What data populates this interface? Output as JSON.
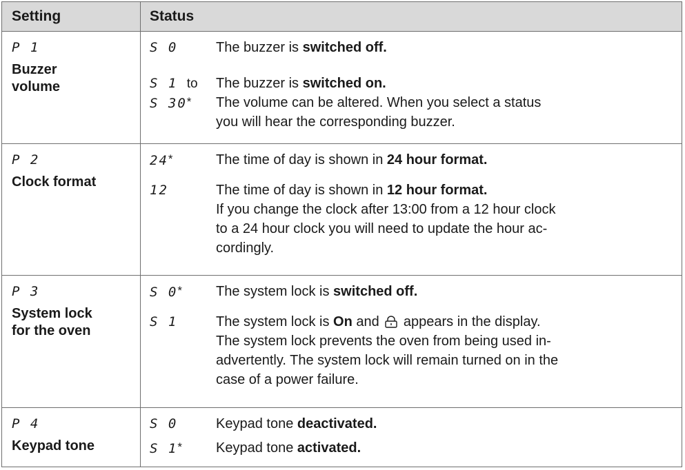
{
  "header": {
    "setting": "Setting",
    "status": "Status"
  },
  "rows": [
    {
      "code": "P 1",
      "name_l1": "Buzzer",
      "name_l2": "volume",
      "statuses": [
        {
          "code": "S 0",
          "star": "",
          "text_pre": "The buzzer is ",
          "text_bold": "switched off.",
          "extra": ""
        },
        {
          "code": "S 1",
          "to": "to",
          "code2": "S 30",
          "star2": "*",
          "text_pre": "The buzzer is ",
          "text_bold": "switched on.",
          "extra1": "The volume can be altered. When you select a status",
          "extra2": "you will hear the corresponding buzzer."
        }
      ]
    },
    {
      "code": "P 2",
      "name_l1": "Clock format",
      "statuses": [
        {
          "code": "24",
          "star": "*",
          "text_pre": "The time of day is shown in ",
          "text_bold": "24 hour format."
        },
        {
          "code": "12",
          "star": "",
          "text_pre": "The time of day is shown in ",
          "text_bold": "12 hour format.",
          "extra1": "If you change the clock after 13:00 from a 12 hour clock",
          "extra2": "to a 24 hour clock you will need to update the hour ac-",
          "extra3": "cordingly."
        }
      ]
    },
    {
      "code": "P 3",
      "name_l1": "System lock",
      "name_l2": "for the oven",
      "statuses": [
        {
          "code": "S 0",
          "star": "*",
          "text_pre": "The system lock is ",
          "text_bold": "switched off."
        },
        {
          "code": "S 1",
          "star": "",
          "text_pre": "The system lock is ",
          "text_bold": "On",
          "text_post": " and ",
          "text_post2": " appears in the display.",
          "extra1": "The system lock prevents the oven from being used in-",
          "extra2": "advertently. The system lock will remain turned on in the",
          "extra3": "case of a power failure."
        }
      ]
    },
    {
      "code": "P 4",
      "name_l1": "Keypad tone",
      "statuses": [
        {
          "code": "S 0",
          "star": "",
          "text_pre": "Keypad tone ",
          "text_bold": "deactivated."
        },
        {
          "code": "S 1",
          "star": "*",
          "text_pre": "Keypad tone ",
          "text_bold": "activated."
        }
      ]
    }
  ],
  "icons": {
    "lock": "lock-icon"
  }
}
